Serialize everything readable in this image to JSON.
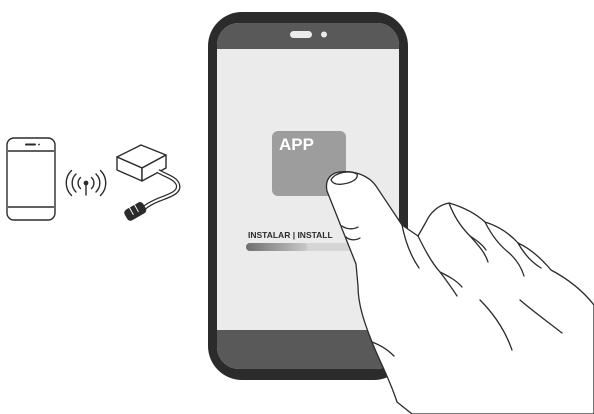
{
  "app_tile": {
    "label": "APP"
  },
  "install": {
    "label": "INSTALAR | INSTALL",
    "progress": 0.55
  },
  "icons": {
    "small_phone": "smartphone-icon",
    "wireless": "wireless-signal-icon",
    "receiver": "receiver-box-icon",
    "hand": "pointing-hand-icon"
  },
  "colors": {
    "phone_frame": "#2b2b2b",
    "screen_band": "#595959",
    "screen_bg": "#ebebeb",
    "app_tile": "#9d9d9d",
    "progress_fill": "#8c8c8c"
  }
}
